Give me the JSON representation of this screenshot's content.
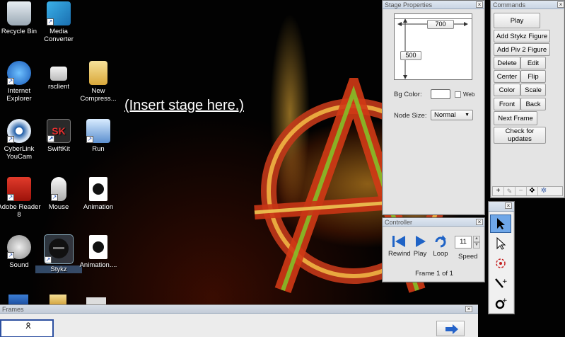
{
  "desktop": {
    "link_text": "(Insert stage here.)",
    "icons": [
      {
        "label": "Recycle Bin"
      },
      {
        "label": "Media Converter"
      },
      {
        "label": "Internet Explorer"
      },
      {
        "label": "rsclient"
      },
      {
        "label": "New Compress..."
      },
      {
        "label": "CyberLink YouCam"
      },
      {
        "label": "SwiftKit"
      },
      {
        "label": "Run"
      },
      {
        "label": "Adobe Reader 8"
      },
      {
        "label": "Mouse"
      },
      {
        "label": "Animation"
      },
      {
        "label": "Sound"
      },
      {
        "label": "Stykz"
      },
      {
        "label": "Animation...."
      }
    ]
  },
  "stage_properties": {
    "title": "Stage Properties",
    "width_value": "700",
    "height_value": "500",
    "bg_color_label": "Bg Color:",
    "web_label": "Web",
    "node_size_label": "Node Size:",
    "node_size_value": "Normal"
  },
  "commands": {
    "title": "Commands",
    "play": "Play",
    "add_stykz": "Add Stykz Figure",
    "add_piv2": "Add Piv 2 Figure",
    "delete": "Delete",
    "edit": "Edit",
    "center": "Center",
    "flip": "Flip",
    "color": "Color",
    "scale": "Scale",
    "front": "Front",
    "back": "Back",
    "next_frame": "Next Frame",
    "check_updates": "Check for updates"
  },
  "controller": {
    "title": "Controller",
    "rewind": "Rewind",
    "play": "Play",
    "loop": "Loop",
    "speed": "Speed",
    "speed_value": "11",
    "frame_status": "Frame 1 of 1"
  },
  "frames": {
    "title": "Frames"
  },
  "colors": {
    "accent": "#1f63c6",
    "tool_active": "#6fa7e8"
  }
}
